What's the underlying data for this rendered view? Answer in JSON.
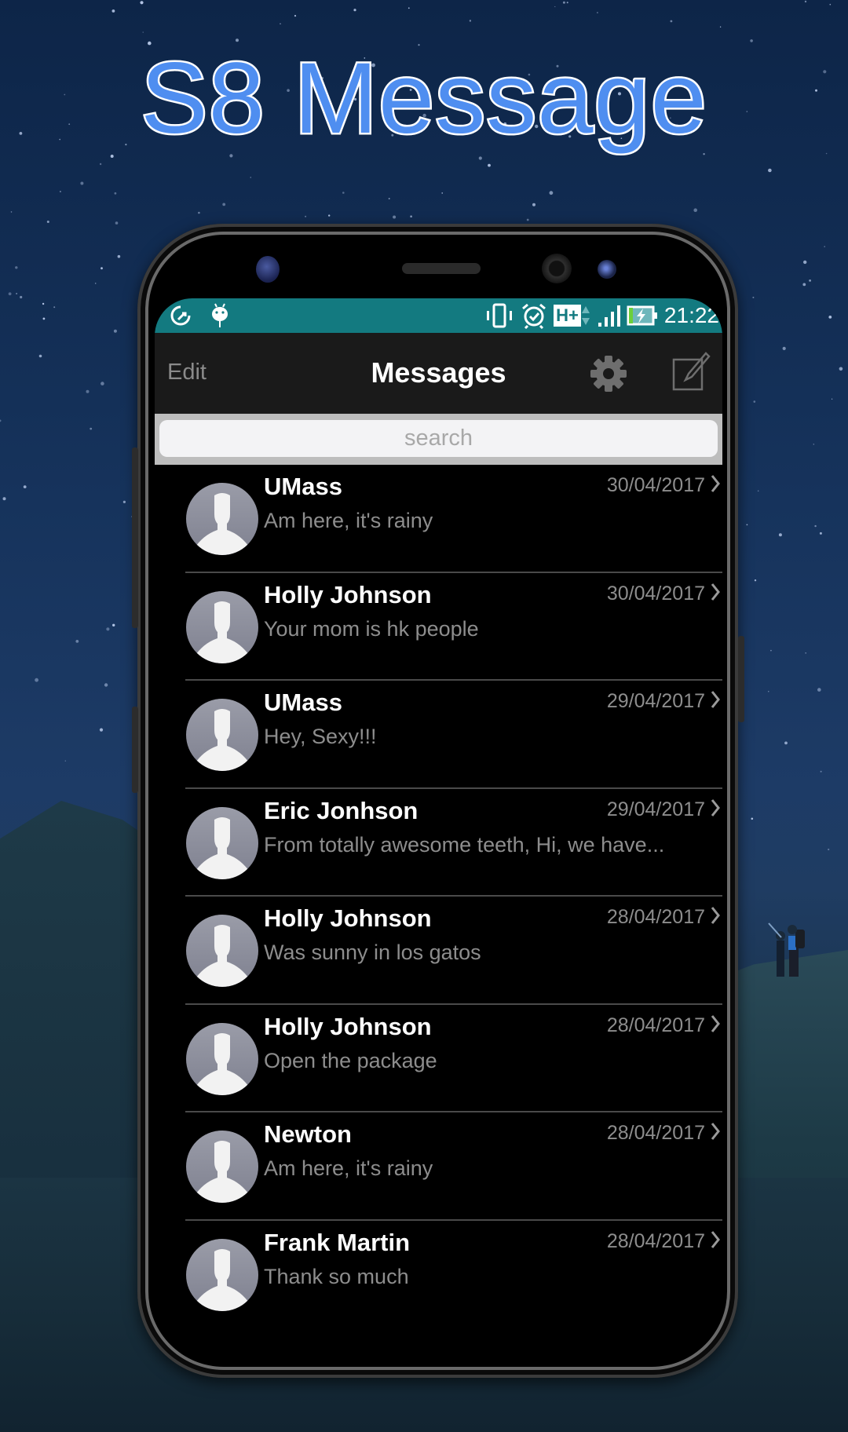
{
  "promo": {
    "title": "S8 Message"
  },
  "status_bar": {
    "left_icons": [
      "data-saver-icon",
      "android-icon"
    ],
    "right_icons": [
      "vibrate-icon",
      "alarm-icon",
      "hplus-network-icon",
      "signal-icon",
      "battery-charging-icon"
    ],
    "network_label": "H+",
    "time": "21:22",
    "color": "#137a80"
  },
  "header": {
    "edit_label": "Edit",
    "title": "Messages",
    "settings_icon": "gear-icon",
    "compose_icon": "compose-icon"
  },
  "search": {
    "placeholder": "search"
  },
  "conversations": [
    {
      "name": "UMass",
      "preview": "Am here, it's rainy",
      "date": "30/04/2017"
    },
    {
      "name": "Holly Johnson",
      "preview": "Your mom is hk people",
      "date": "30/04/2017"
    },
    {
      "name": "UMass",
      "preview": "Hey, Sexy!!!",
      "date": "29/04/2017"
    },
    {
      "name": "Eric Jonhson",
      "preview": "From totally awesome teeth, Hi, we have...",
      "date": "29/04/2017"
    },
    {
      "name": "Holly Johnson",
      "preview": "Was sunny in los gatos",
      "date": "28/04/2017"
    },
    {
      "name": "Holly Johnson",
      "preview": "Open the package",
      "date": "28/04/2017"
    },
    {
      "name": "Newton",
      "preview": "Am here, it's rainy",
      "date": "28/04/2017"
    },
    {
      "name": "Frank Martin",
      "preview": "Thank so much",
      "date": "28/04/2017"
    }
  ],
  "colors": {
    "title_blue": "#4f8ef0",
    "header_bg": "#1a1a1a",
    "search_band": "#bdbdbd"
  }
}
